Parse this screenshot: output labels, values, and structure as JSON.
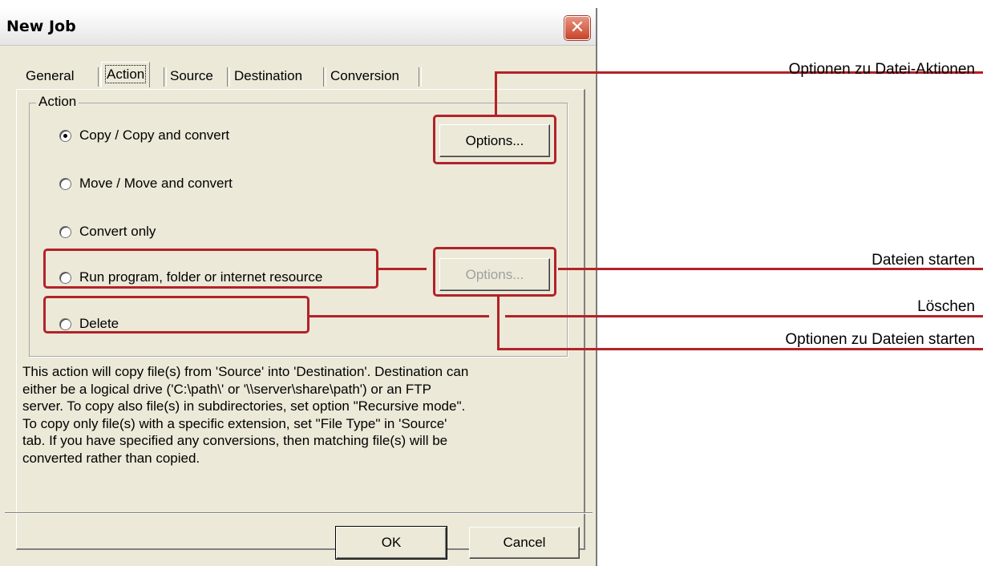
{
  "window": {
    "title": "New Job",
    "close_glyph": "✕"
  },
  "tabs": [
    {
      "label": "General",
      "active": false
    },
    {
      "label": "Action",
      "active": true
    },
    {
      "label": "Source",
      "active": false
    },
    {
      "label": "Destination",
      "active": false
    },
    {
      "label": "Conversion",
      "active": false
    }
  ],
  "action_group": {
    "label": "Action",
    "options": [
      {
        "label": "Copy / Copy and convert",
        "checked": true
      },
      {
        "label": "Move / Move and convert",
        "checked": false
      },
      {
        "label": "Convert only",
        "checked": false
      },
      {
        "label": "Run program, folder or internet resource",
        "checked": false
      },
      {
        "label": "Delete",
        "checked": false
      }
    ],
    "options_button": "Options...",
    "options_button_disabled": "Options..."
  },
  "description": "This action will copy file(s) from 'Source' into 'Destination'. Destination can\neither be a logical drive ('C:\\path\\' or '\\\\server\\share\\path') or an FTP\nserver. To copy also file(s) in subdirectories, set option \"Recursive mode\".\nTo copy only file(s) with a specific extension, set \"File Type\" in 'Source'\ntab. If you have specified any conversions, then matching file(s) will be\nconverted rather than copied.",
  "footer": {
    "ok": "OK",
    "cancel": "Cancel"
  },
  "annotations": {
    "file_action_options": "Optionen zu Datei-Aktionen",
    "start_files": "Dateien starten",
    "delete": "Löschen",
    "start_files_options": "Optionen zu Dateien starten",
    "color": "#b32228"
  }
}
